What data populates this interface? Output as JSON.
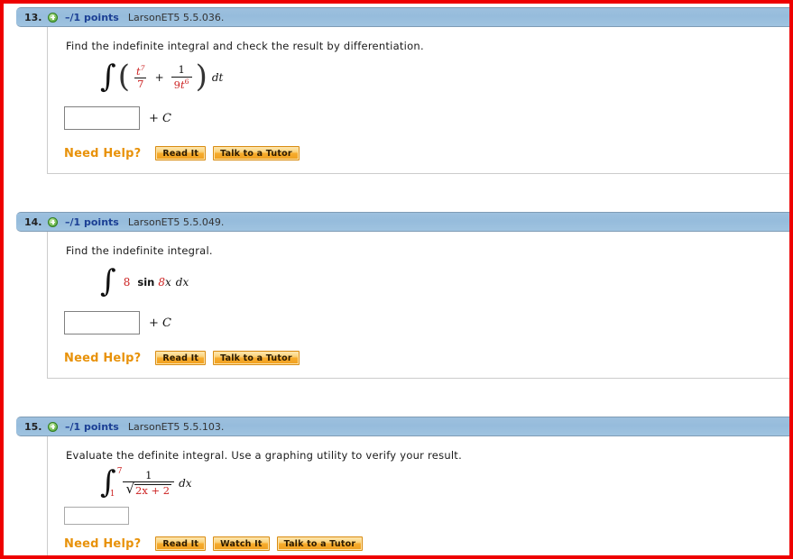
{
  "page": {
    "border_color": "#ee0000",
    "header_bg": "#9cc0de",
    "points_color": "#1b3f94",
    "need_help_color": "#e8920a",
    "math_accent_color": "#cc2222"
  },
  "questions": [
    {
      "number": "13.",
      "expand_icon": "plus-circle-icon",
      "points": "–/1 points",
      "reference": "LarsonET5 5.5.036.",
      "prompt": "Find the indefinite integral and check the result by differentiation.",
      "math": {
        "kind": "indefinite-sum-fraction",
        "integral_symbol": "∫",
        "open_paren": "(",
        "close_paren": ")",
        "term1_num": "t",
        "term1_num_exp": "7",
        "term1_den": "7",
        "operator": "+",
        "term2_num": "1",
        "term2_den": "9t",
        "term2_den_exp": "6",
        "differential": "dt"
      },
      "answer": {
        "value": "",
        "placeholder": ""
      },
      "answer_suffix": "+ C",
      "answer_suffix_const": "C",
      "answer_suffix_plus": "+ ",
      "need_help_label": "Need Help?",
      "help_buttons": [
        "Read It",
        "Talk to a Tutor"
      ]
    },
    {
      "number": "14.",
      "expand_icon": "plus-circle-icon",
      "points": "–/1 points",
      "reference": "LarsonET5 5.5.049.",
      "prompt": "Find the indefinite integral.",
      "math": {
        "kind": "indefinite-trig",
        "integral_symbol": "∫",
        "coefficient": "8",
        "function": "sin",
        "argument_coeff": "8",
        "argument_var": "x",
        "differential": "dx"
      },
      "answer": {
        "value": "",
        "placeholder": ""
      },
      "answer_suffix": "+ C",
      "answer_suffix_const": "C",
      "answer_suffix_plus": "+ ",
      "need_help_label": "Need Help?",
      "help_buttons": [
        "Read It",
        "Talk to a Tutor"
      ]
    },
    {
      "number": "15.",
      "expand_icon": "plus-circle-icon",
      "points": "–/1 points",
      "reference": "LarsonET5 5.5.103.",
      "prompt": "Evaluate the definite integral. Use a graphing utility to verify your result.",
      "math": {
        "kind": "definite-radical-fraction",
        "integral_symbol": "∫",
        "upper_limit": "7",
        "lower_limit": "1",
        "numerator": "1",
        "radical_symbol": "√",
        "radicand": "2x + 2",
        "differential": "dx"
      },
      "answer": {
        "value": "",
        "placeholder": ""
      },
      "answer_suffix": "",
      "need_help_label": "Need Help?",
      "help_buttons": [
        "Read It",
        "Watch It",
        "Talk to a Tutor"
      ]
    }
  ]
}
